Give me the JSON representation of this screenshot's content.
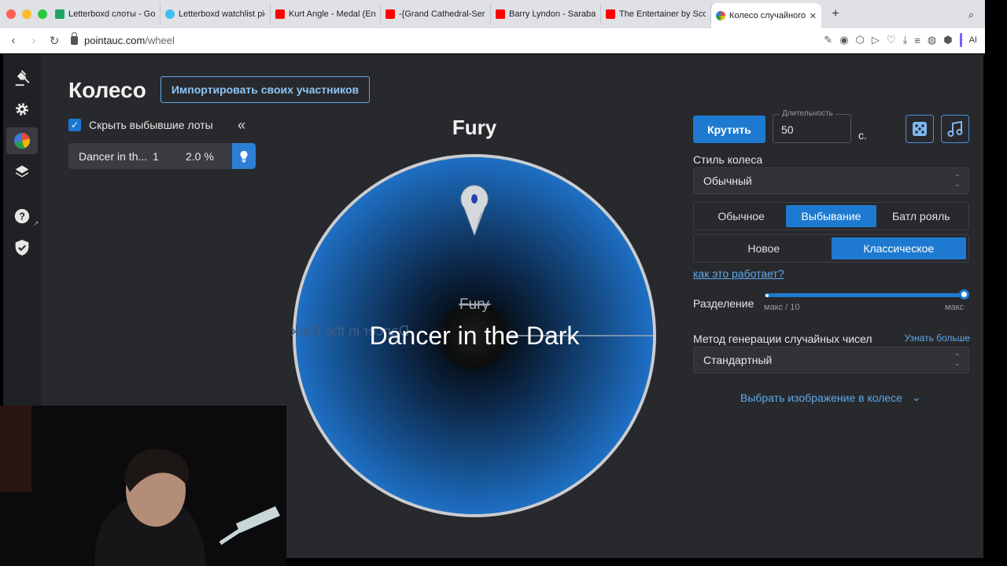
{
  "browser": {
    "tabs": [
      {
        "label": "Letterboxd слоты - Goog",
        "color": "#1fa463",
        "active": false
      },
      {
        "label": "Letterboxd watchlist pic",
        "color": "#40bcf4",
        "active": false
      },
      {
        "label": "Kurt Angle - Medal (Entr",
        "color": "#ff0000",
        "active": false
      },
      {
        "label": "-{Grand Cathedral-Serio",
        "color": "#ff0000",
        "active": false
      },
      {
        "label": "Barry Lyndon - Saraband",
        "color": "#ff0000",
        "active": false
      },
      {
        "label": "The Entertainer by Scott",
        "color": "#ff0000",
        "active": false
      },
      {
        "label": "Колесо случайного вы",
        "color": "#e0503c",
        "active": true
      }
    ],
    "url_host": "pointauc.com",
    "url_path": "/wheel",
    "ai_label": "AI"
  },
  "page": {
    "title": "Колесо",
    "import_button": "Импортировать своих участников",
    "hide_eliminated_label": "Скрыть выбывшие лоты",
    "hide_eliminated_checked": true
  },
  "lots": [
    {
      "name": "Dancer in th...",
      "count": "1",
      "percent": "2.0 %"
    }
  ],
  "wheel": {
    "winner": "Fury",
    "crossed_out": "Fury",
    "current": "Dancer in the Dark",
    "mirrored_label": "Dancer in the Dark",
    "color": "#1e6fc4"
  },
  "controls": {
    "spin_button": "Крутить",
    "duration_label": "Длительность",
    "duration_value": "50",
    "duration_unit": "с.",
    "style_label": "Стиль колеса",
    "style_value": "Обычный",
    "mode_options": [
      "Обычное",
      "Выбывание",
      "Батл рояль"
    ],
    "mode_selected": "Выбывание",
    "variant_options": [
      "Новое",
      "Классическое"
    ],
    "variant_selected": "Классическое",
    "how_link": "как это работает?",
    "split_label": "Разделение",
    "split_min": "макс / 10",
    "split_max": "макс",
    "split_level": 1.0,
    "rng_label": "Метод генерации случайных чисел",
    "rng_learn_more": "Узнать больше",
    "rng_value": "Стандартный",
    "pick_image": "Выбрать изображение в колесе"
  }
}
